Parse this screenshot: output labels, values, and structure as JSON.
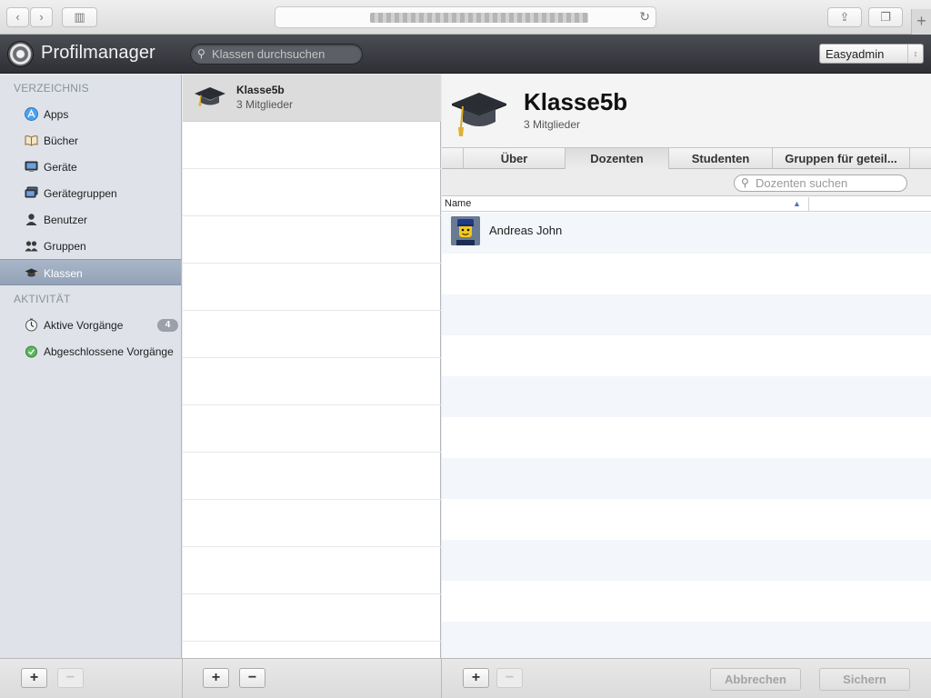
{
  "app": {
    "title": "Profilmanager",
    "search_placeholder": "Klassen durchsuchen",
    "user_menu": "Easyadmin"
  },
  "sidebar": {
    "section_library": "VERZEICHNIS",
    "items": [
      {
        "label": "Apps",
        "icon": "apps-icon"
      },
      {
        "label": "Bücher",
        "icon": "books-icon"
      },
      {
        "label": "Geräte",
        "icon": "devices-icon"
      },
      {
        "label": "Gerätegruppen",
        "icon": "device-groups-icon"
      },
      {
        "label": "Benutzer",
        "icon": "user-icon"
      },
      {
        "label": "Gruppen",
        "icon": "groups-icon"
      },
      {
        "label": "Klassen",
        "icon": "graduation-cap-icon",
        "selected": true
      }
    ],
    "section_activity": "AKTIVITÄT",
    "activity": [
      {
        "label": "Aktive Vorgänge",
        "badge": "4",
        "icon": "timer-icon"
      },
      {
        "label": "Abgeschlossene Vorgänge",
        "icon": "completed-icon"
      }
    ]
  },
  "class_list": [
    {
      "name": "Klasse5b",
      "members": "3 Mitglieder",
      "selected": true
    }
  ],
  "detail": {
    "title": "Klasse5b",
    "subtitle": "3 Mitglieder",
    "tabs": [
      "Über",
      "Dozenten",
      "Studenten",
      "Gruppen für geteil..."
    ],
    "active_tab": 1,
    "search_placeholder": "Dozenten suchen",
    "column_name": "Name",
    "teachers": [
      "Andreas John"
    ]
  },
  "footer": {
    "add_label": "+",
    "remove_label": "−",
    "cancel_label": "Abbrechen",
    "save_label": "Sichern"
  },
  "colors": {
    "header_bg": "#3a3d43",
    "sidebar_bg": "#dfe3e9",
    "selected_sidebar": "#9fadc1",
    "badge_bg": "#9aa1ab"
  }
}
